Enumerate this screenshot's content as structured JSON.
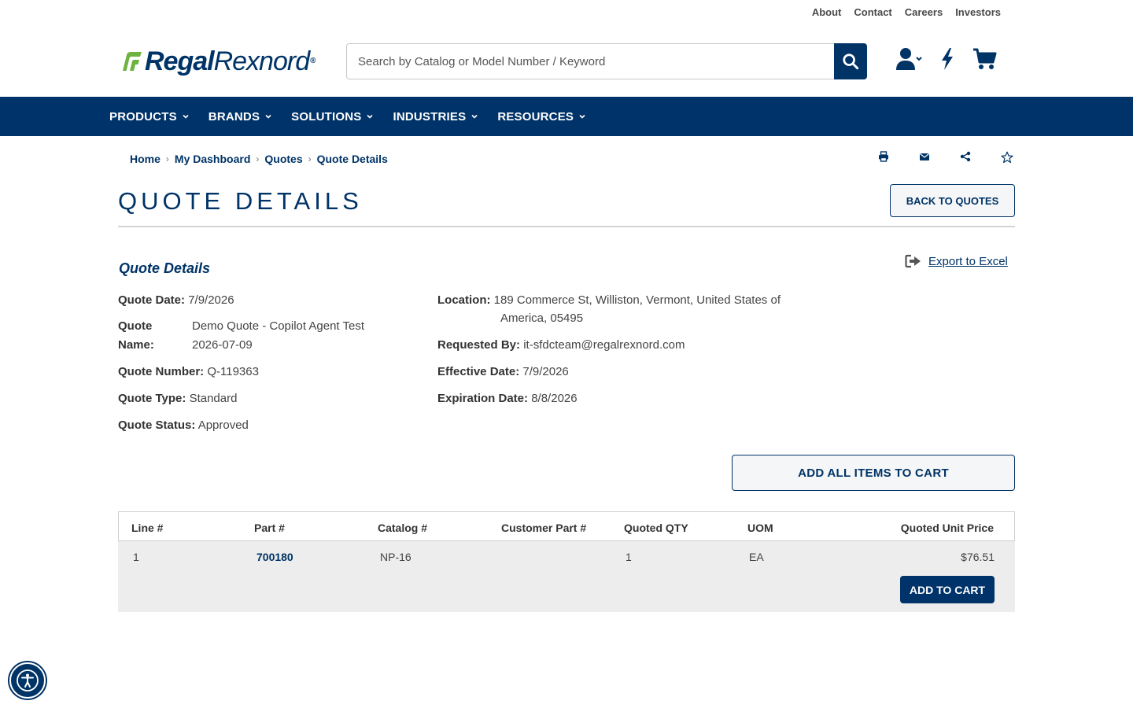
{
  "utility_nav": [
    "About",
    "Contact",
    "Careers",
    "Investors"
  ],
  "logo": {
    "bold": "Regal",
    "light": "Rexnord",
    "mark": "®"
  },
  "search": {
    "placeholder": "Search by Catalog or Model Number / Keyword",
    "value": ""
  },
  "header_icons": [
    "user-icon",
    "lightning-icon",
    "cart-icon"
  ],
  "main_nav": [
    "PRODUCTS",
    "BRANDS",
    "SOLUTIONS",
    "INDUSTRIES",
    "RESOURCES"
  ],
  "breadcrumb": {
    "items": [
      "Home",
      "My Dashboard",
      "Quotes"
    ],
    "current": "Quote Details"
  },
  "tools": [
    "print-icon",
    "email-icon",
    "share-icon",
    "star-icon"
  ],
  "page_title": "QUOTE DETAILS",
  "back_button": "BACK TO QUOTES",
  "section_title": "Quote Details",
  "export_label": "Export to Excel",
  "details": {
    "quote_date_label": "Quote Date:",
    "quote_date": "7/9/2026",
    "quote_name_label_1": "Quote",
    "quote_name_label_2": "Name:",
    "quote_name_1": "Demo Quote - Copilot Agent Test",
    "quote_name_2": "2026-07-09",
    "quote_number_label": "Quote Number:",
    "quote_number": "Q-119363",
    "quote_type_label": "Quote Type:",
    "quote_type": "Standard",
    "quote_status_label": "Quote Status:",
    "quote_status": "Approved",
    "location_label": "Location:",
    "location_1": "189 Commerce St, Williston, Vermont, United States of",
    "location_2": "America, 05495",
    "requested_by_label": "Requested By:",
    "requested_by": "it-sfdcteam@regalrexnord.com",
    "effective_date_label": "Effective Date:",
    "effective_date": "7/9/2026",
    "expiration_date_label": "Expiration Date:",
    "expiration_date": "8/8/2026"
  },
  "add_all_button": "ADD ALL ITEMS TO CART",
  "table": {
    "headers": [
      "Line #",
      "Part #",
      "Catalog #",
      "Customer Part #",
      "Quoted QTY",
      "UOM",
      "Quoted Unit Price"
    ],
    "rows": [
      {
        "line": "1",
        "part": "700180",
        "catalog": "NP-16",
        "customer_part": "",
        "qty": "1",
        "uom": "EA",
        "price": "$76.51",
        "button": "ADD TO CART"
      }
    ]
  },
  "colors": {
    "brand_navy": "#003366",
    "nav_bg": "#003369",
    "logo_green": "#6cb33f"
  }
}
